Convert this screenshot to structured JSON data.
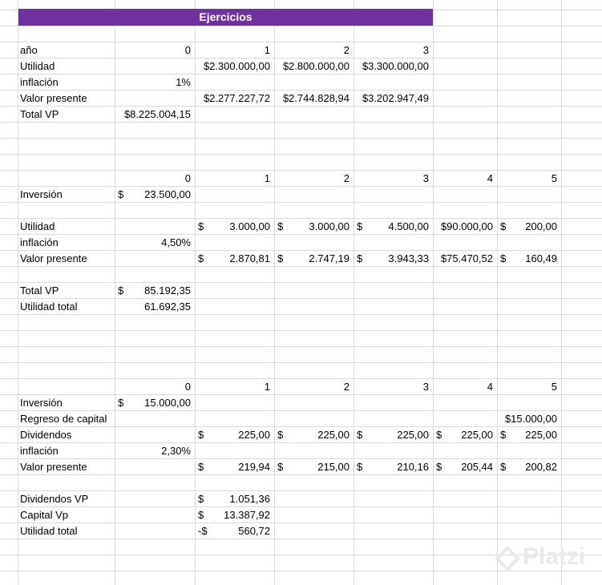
{
  "title": "Ejercicios",
  "watermark": "Platzi",
  "colors": {
    "title_bg": "#7030a0",
    "title_fg": "#ffffff",
    "grid": "#dadada"
  },
  "cells": [
    {
      "row": 2,
      "col": 0,
      "text": "año"
    },
    {
      "row": 2,
      "col": 1,
      "num": "0"
    },
    {
      "row": 2,
      "col": 2,
      "num": "1"
    },
    {
      "row": 2,
      "col": 3,
      "num": "2"
    },
    {
      "row": 2,
      "col": 4,
      "num": "3"
    },
    {
      "row": 3,
      "col": 0,
      "text": "Utilidad"
    },
    {
      "row": 3,
      "col": 2,
      "cur": "$",
      "num": "2.300.000,00",
      "tight": true
    },
    {
      "row": 3,
      "col": 3,
      "cur": "$",
      "num": "2.800.000,00",
      "tight": true
    },
    {
      "row": 3,
      "col": 4,
      "cur": "$",
      "num": "3.300.000,00",
      "tight": true
    },
    {
      "row": 4,
      "col": 0,
      "text": "inflación"
    },
    {
      "row": 4,
      "col": 1,
      "num": "1%"
    },
    {
      "row": 5,
      "col": 0,
      "text": "Valor presente"
    },
    {
      "row": 5,
      "col": 2,
      "cur": "$",
      "num": "2.277.227,72",
      "tight": true
    },
    {
      "row": 5,
      "col": 3,
      "cur": "$",
      "num": "2.744.828,94",
      "tight": true
    },
    {
      "row": 5,
      "col": 4,
      "cur": "$",
      "num": "3.202.947,49",
      "tight": true
    },
    {
      "row": 6,
      "col": 0,
      "text": "Total VP"
    },
    {
      "row": 6,
      "col": 1,
      "cur": "$",
      "num": "8.225.004,15",
      "tight": true
    },
    {
      "row": 10,
      "col": 1,
      "num": "0"
    },
    {
      "row": 10,
      "col": 2,
      "num": "1"
    },
    {
      "row": 10,
      "col": 3,
      "num": "2"
    },
    {
      "row": 10,
      "col": 4,
      "num": "3"
    },
    {
      "row": 10,
      "col": 5,
      "num": "4"
    },
    {
      "row": 10,
      "col": 6,
      "num": "5"
    },
    {
      "row": 11,
      "col": 0,
      "text": "Inversión"
    },
    {
      "row": 11,
      "col": 1,
      "cur": "$",
      "num": "23.500,00"
    },
    {
      "row": 13,
      "col": 0,
      "text": "Utilidad"
    },
    {
      "row": 13,
      "col": 2,
      "cur": "$",
      "num": "3.000,00"
    },
    {
      "row": 13,
      "col": 3,
      "cur": "$",
      "num": "3.000,00"
    },
    {
      "row": 13,
      "col": 4,
      "cur": "$",
      "num": "4.500,00"
    },
    {
      "row": 13,
      "col": 5,
      "cur": "$",
      "num": "90.000,00",
      "tight": true
    },
    {
      "row": 13,
      "col": 6,
      "cur": "$",
      "num": "200,00"
    },
    {
      "row": 14,
      "col": 0,
      "text": "inflación"
    },
    {
      "row": 14,
      "col": 1,
      "num": "4,50%"
    },
    {
      "row": 15,
      "col": 0,
      "text": "Valor presente"
    },
    {
      "row": 15,
      "col": 2,
      "cur": "$",
      "num": "2.870,81"
    },
    {
      "row": 15,
      "col": 3,
      "cur": "$",
      "num": "2.747,19"
    },
    {
      "row": 15,
      "col": 4,
      "cur": "$",
      "num": "3.943,33"
    },
    {
      "row": 15,
      "col": 5,
      "cur": "$",
      "num": "75.470,52",
      "tight": true
    },
    {
      "row": 15,
      "col": 6,
      "cur": "$",
      "num": "160,49"
    },
    {
      "row": 17,
      "col": 0,
      "text": "Total VP"
    },
    {
      "row": 17,
      "col": 1,
      "cur": "$",
      "num": "85.192,35"
    },
    {
      "row": 18,
      "col": 0,
      "text": "Utilidad total"
    },
    {
      "row": 18,
      "col": 1,
      "num": "61.692,35"
    },
    {
      "row": 23,
      "col": 1,
      "num": "0"
    },
    {
      "row": 23,
      "col": 2,
      "num": "1"
    },
    {
      "row": 23,
      "col": 3,
      "num": "2"
    },
    {
      "row": 23,
      "col": 4,
      "num": "3"
    },
    {
      "row": 23,
      "col": 5,
      "num": "4"
    },
    {
      "row": 23,
      "col": 6,
      "num": "5"
    },
    {
      "row": 24,
      "col": 0,
      "text": "Inversión"
    },
    {
      "row": 24,
      "col": 1,
      "cur": "$",
      "num": "15.000,00"
    },
    {
      "row": 25,
      "col": 0,
      "text": "Regreso de capital"
    },
    {
      "row": 25,
      "col": 6,
      "cur": "$",
      "num": "15.000,00",
      "tight": true
    },
    {
      "row": 26,
      "col": 0,
      "text": "Dividendos"
    },
    {
      "row": 26,
      "col": 2,
      "cur": "$",
      "num": "225,00"
    },
    {
      "row": 26,
      "col": 3,
      "cur": "$",
      "num": "225,00"
    },
    {
      "row": 26,
      "col": 4,
      "cur": "$",
      "num": "225,00"
    },
    {
      "row": 26,
      "col": 5,
      "cur": "$",
      "num": "225,00"
    },
    {
      "row": 26,
      "col": 6,
      "cur": "$",
      "num": "225,00"
    },
    {
      "row": 27,
      "col": 0,
      "text": "inflación"
    },
    {
      "row": 27,
      "col": 1,
      "num": "2,30%"
    },
    {
      "row": 28,
      "col": 0,
      "text": "Valor presente"
    },
    {
      "row": 28,
      "col": 2,
      "cur": "$",
      "num": "219,94"
    },
    {
      "row": 28,
      "col": 3,
      "cur": "$",
      "num": "215,00"
    },
    {
      "row": 28,
      "col": 4,
      "cur": "$",
      "num": "210,16"
    },
    {
      "row": 28,
      "col": 5,
      "cur": "$",
      "num": "205,44"
    },
    {
      "row": 28,
      "col": 6,
      "cur": "$",
      "num": "200,82"
    },
    {
      "row": 30,
      "col": 0,
      "text": "Dividendos VP"
    },
    {
      "row": 30,
      "col": 2,
      "cur": "$",
      "num": "1.051,36"
    },
    {
      "row": 31,
      "col": 0,
      "text": "Capital Vp"
    },
    {
      "row": 31,
      "col": 2,
      "cur": "$",
      "num": "13.387,92"
    },
    {
      "row": 32,
      "col": 0,
      "text": "Utilidad total"
    },
    {
      "row": 32,
      "col": 2,
      "cur": "-$",
      "num": "560,72"
    }
  ]
}
